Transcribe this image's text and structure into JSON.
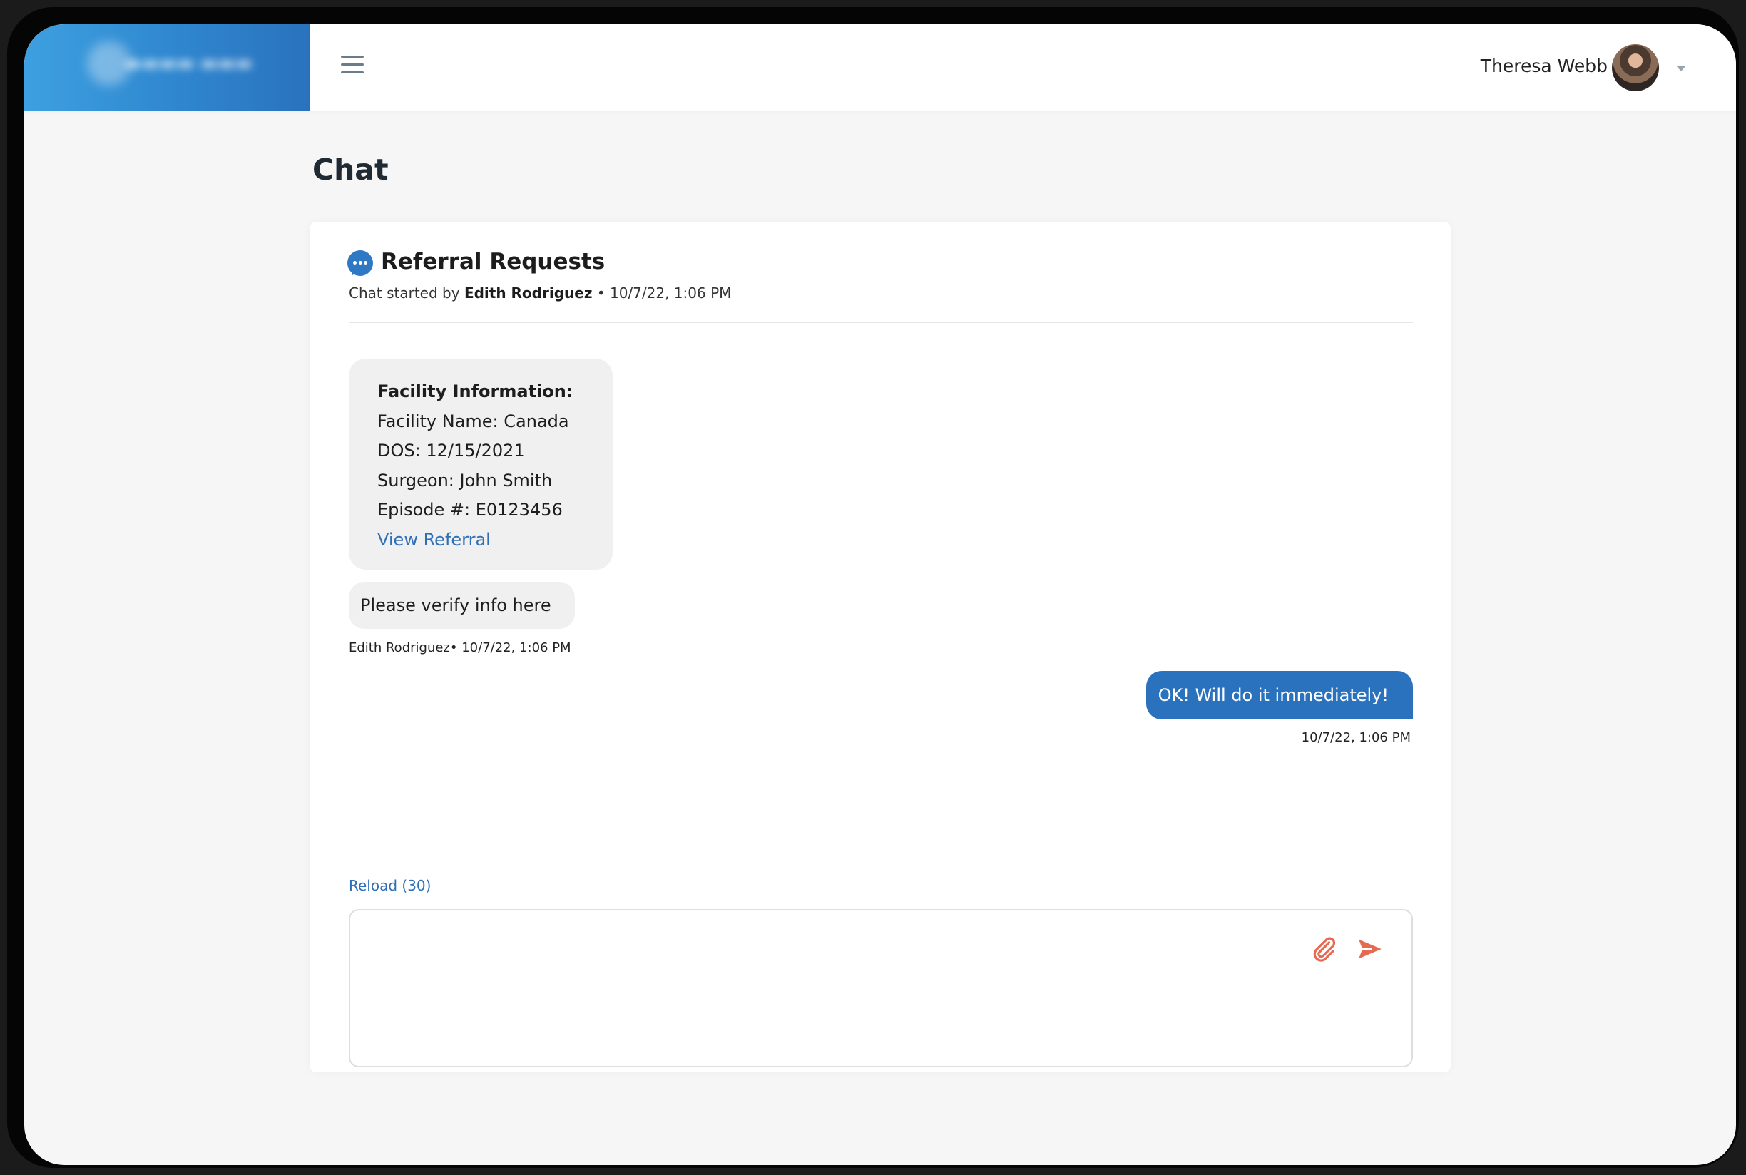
{
  "header": {
    "user_name": "Theresa Webb"
  },
  "page": {
    "title": "Chat"
  },
  "chat": {
    "title": "Referral Requests",
    "started_prefix": "Chat started by ",
    "started_by": "Edith Rodriguez",
    "started_suffix": " • 10/7/22, 1:06 PM",
    "facility": {
      "heading": "Facility Information:",
      "name": "Facility Name: Canada",
      "dos": "DOS: 12/15/2021",
      "surgeon": "Surgeon: John Smith",
      "episode": "Episode #: E0123456",
      "link_label": "View Referral"
    },
    "messages": [
      {
        "text": "Please verify info here",
        "meta": "Edith Rodriguez• 10/7/22, 1:06 PM"
      },
      {
        "text": "OK! Will do it immediately!",
        "meta": "10/7/22, 1:06 PM"
      }
    ],
    "reload_label": "Reload (30)",
    "composer_value": ""
  },
  "colors": {
    "accent": "#2a72bd",
    "action_icons": "#e56a4f",
    "link": "#2f6fb7"
  },
  "icons": [
    "menu-icon",
    "chat-bubble-icon",
    "paperclip-icon",
    "send-icon",
    "chevron-down-icon"
  ]
}
